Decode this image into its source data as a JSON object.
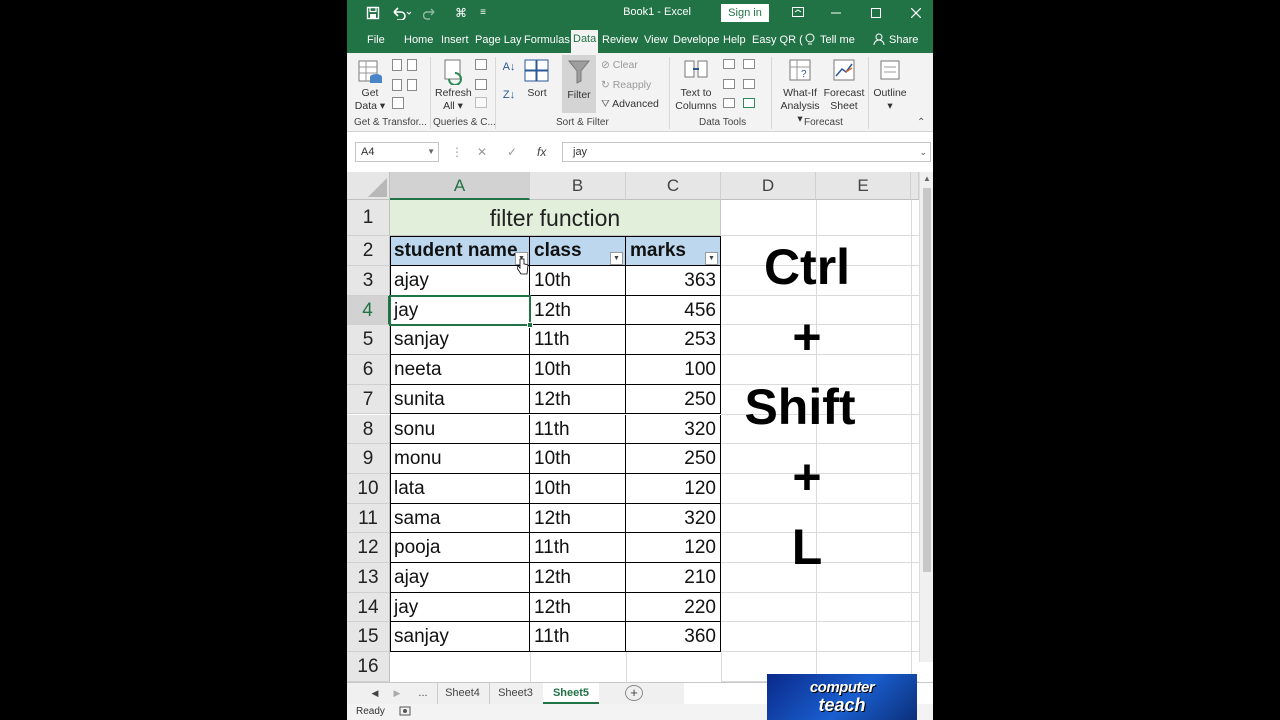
{
  "titlebar": {
    "title": "Book1  -  Excel",
    "signin": "Sign in",
    "save_icon": "save-icon",
    "undo_icon": "undo-icon",
    "redo_icon": "redo-icon"
  },
  "tabs": [
    "File",
    "Home",
    "Insert",
    "Page Lay",
    "Formulas",
    "Data",
    "Review",
    "View",
    "Develope",
    "Help",
    "Easy QR (",
    "Tell me",
    "Share"
  ],
  "ribbon": {
    "get_data": [
      "Get",
      "Data"
    ],
    "refresh_all": [
      "Refresh",
      "All"
    ],
    "sort": "Sort",
    "filter": "Filter",
    "clear": "Clear",
    "reapply": "Reapply",
    "advanced": "Advanced",
    "text_to_columns": [
      "Text to",
      "Columns"
    ],
    "what_if": [
      "What-If",
      "Analysis"
    ],
    "forecast_sheet": [
      "Forecast",
      "Sheet"
    ],
    "outline": "Outline",
    "groups": [
      "Get & Transfor...",
      "Queries & C...",
      "Sort & Filter",
      "Data Tools",
      "Forecast"
    ]
  },
  "formula_bar": {
    "name_box": "A4",
    "cancel": "✕",
    "enter": "✓",
    "fx": "fx",
    "value": "jay"
  },
  "grid": {
    "columns": [
      "A",
      "B",
      "C",
      "D",
      "E"
    ],
    "rows": [
      "1",
      "2",
      "3",
      "4",
      "5",
      "6",
      "7",
      "8",
      "9",
      "10",
      "11",
      "12",
      "13",
      "14",
      "15",
      "16"
    ],
    "title": "filter function",
    "headers": [
      "student name",
      "class",
      "marks"
    ],
    "data": [
      [
        "ajay",
        "10th",
        "363"
      ],
      [
        "jay",
        "12th",
        "456"
      ],
      [
        "sanjay",
        "11th",
        "253"
      ],
      [
        "neeta",
        "10th",
        "100"
      ],
      [
        "sunita",
        "12th",
        "250"
      ],
      [
        "sonu",
        "11th",
        "320"
      ],
      [
        "monu",
        "10th",
        "250"
      ],
      [
        "lata",
        "10th",
        "120"
      ],
      [
        "sama",
        "12th",
        "320"
      ],
      [
        "pooja",
        "11th",
        "120"
      ],
      [
        "ajay",
        "12th",
        "210"
      ],
      [
        "jay",
        "12th",
        "220"
      ],
      [
        "sanjay",
        "11th",
        "360"
      ]
    ],
    "selected_cell": "A4"
  },
  "shortcut": [
    "Ctrl",
    "+",
    "Shift",
    "+",
    "L"
  ],
  "sheets": {
    "ellipsis": "...",
    "tabs": [
      "Sheet4",
      "Sheet3",
      "Sheet5"
    ],
    "active": "Sheet5",
    "add": "+"
  },
  "status": "Ready",
  "logo": [
    "computer",
    "teach"
  ],
  "colors": {
    "excel_green": "#217346",
    "header_fill": "#bdd7ee",
    "title_fill": "#e2efda"
  }
}
